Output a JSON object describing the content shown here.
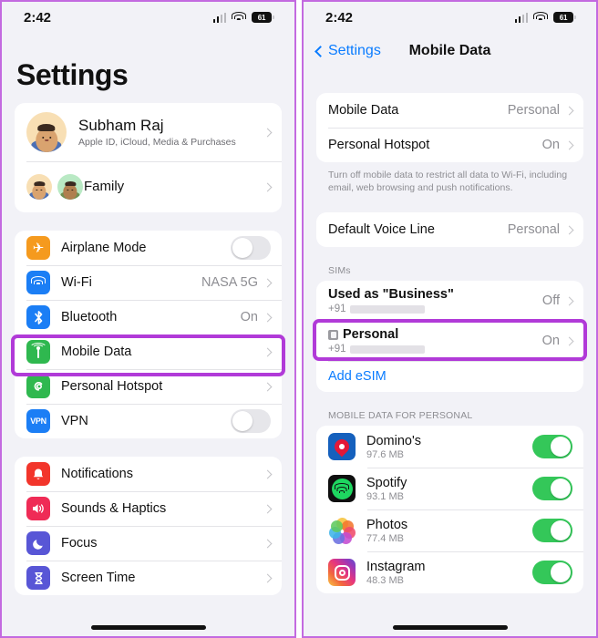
{
  "statusbar": {
    "time": "2:42",
    "battery_level": "61",
    "icons": [
      "signal-icon",
      "wifi-icon",
      "battery-icon"
    ]
  },
  "left_phone": {
    "title": "Settings",
    "account": {
      "name": "Subham Raj",
      "subtitle": "Apple ID, iCloud, Media & Purchases",
      "family_label": "Family"
    },
    "group1": [
      {
        "label": "Airplane Mode",
        "icon": "airplane-icon",
        "control": "toggle",
        "state": "off",
        "tile": "#f59a1e"
      },
      {
        "label": "Wi-Fi",
        "icon": "wifi-icon",
        "control": "value",
        "value": "NASA 5G",
        "tile": "#1b7ef5"
      },
      {
        "label": "Bluetooth",
        "icon": "bluetooth-icon",
        "control": "value",
        "value": "On",
        "tile": "#1b7ef5"
      },
      {
        "label": "Mobile Data",
        "icon": "antenna-icon",
        "control": "value",
        "value": "",
        "tile": "#2fb84f",
        "highlighted": true
      },
      {
        "label": "Personal Hotspot",
        "icon": "hotspot-icon",
        "control": "value",
        "value": "",
        "tile": "#2fb84f"
      },
      {
        "label": "VPN",
        "icon": "vpn-icon",
        "control": "toggle",
        "state": "off",
        "tile": "#1b7ef5"
      }
    ],
    "group2": [
      {
        "label": "Notifications",
        "icon": "bell-icon",
        "tile": "#f2352b"
      },
      {
        "label": "Sounds & Haptics",
        "icon": "speaker-icon",
        "tile": "#ef2b56"
      },
      {
        "label": "Focus",
        "icon": "moon-icon",
        "tile": "#5856d6"
      },
      {
        "label": "Screen Time",
        "icon": "hourglass-icon",
        "tile": "#5856d6"
      }
    ]
  },
  "right_phone": {
    "nav": {
      "back_label": "Settings",
      "title": "Mobile Data"
    },
    "group1": [
      {
        "label": "Mobile Data",
        "value": "Personal"
      },
      {
        "label": "Personal Hotspot",
        "value": "On"
      }
    ],
    "footnote": "Turn off mobile data to restrict all data to Wi-Fi, including email, web browsing and push notifications.",
    "group2": [
      {
        "label": "Default Voice Line",
        "value": "Personal"
      }
    ],
    "sims_header": "SIMs",
    "sims": [
      {
        "title": "Used as \"Business\"",
        "sub_prefix": "+91",
        "value": "Off",
        "has_sim_icon": false,
        "highlighted": false
      },
      {
        "title": "Personal",
        "sub_prefix": "+91",
        "value": "On",
        "has_sim_icon": true,
        "highlighted": true
      }
    ],
    "add_esim_label": "Add eSIM",
    "apps_header": "MOBILE DATA FOR PERSONAL",
    "apps": [
      {
        "name": "Domino's",
        "size": "97.6 MB",
        "state": "on",
        "icon": "dominos-icon"
      },
      {
        "name": "Spotify",
        "size": "93.1 MB",
        "state": "on",
        "icon": "spotify-icon"
      },
      {
        "name": "Photos",
        "size": "77.4 MB",
        "state": "on",
        "icon": "photos-icon"
      },
      {
        "name": "Instagram",
        "size": "48.3 MB",
        "state": "on",
        "icon": "instagram-icon"
      }
    ]
  },
  "colors": {
    "highlight": "#b13ad8",
    "accent_blue": "#0a7cff",
    "toggle_on": "#34c759"
  }
}
